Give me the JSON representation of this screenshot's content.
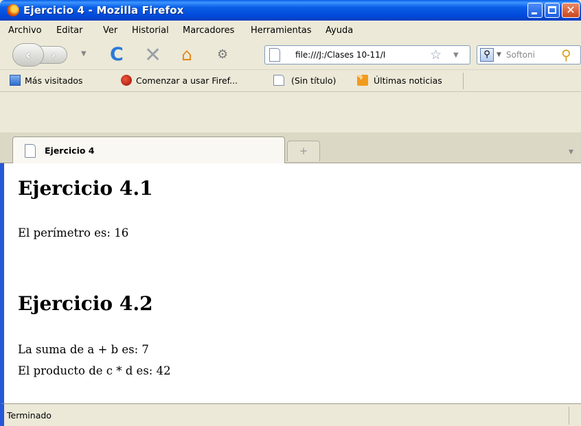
{
  "window": {
    "title": "Ejercicio 4 - Mozilla Firefox"
  },
  "menu": {
    "items": [
      {
        "label": "Archivo"
      },
      {
        "label": "Editar"
      },
      {
        "label": "Ver"
      },
      {
        "label": "Historial"
      },
      {
        "label": "Marcadores"
      },
      {
        "label": "Herramientas"
      },
      {
        "label": "Ayuda"
      }
    ]
  },
  "toolbar": {
    "back_icon": "back-arrow-icon",
    "forward_icon": "forward-arrow-icon",
    "reload_icon": "reload-icon",
    "stop_icon": "stop-icon",
    "home_icon": "home-icon",
    "url": "file:///J:/Clases 10-11/I",
    "search_placeholder": "Softoni"
  },
  "bookmarks": {
    "items": [
      {
        "label": "Más visitados"
      },
      {
        "label": "Comenzar a usar Firef..."
      },
      {
        "label": "(Sin título)"
      },
      {
        "label": "Últimas noticias"
      }
    ]
  },
  "tabs": {
    "active": {
      "label": "Ejercicio 4"
    },
    "new_tab_symbol": "+"
  },
  "page": {
    "section1": {
      "heading": "Ejercicio 4.1",
      "line1": "El perímetro es: 16"
    },
    "section2": {
      "heading": "Ejercicio 4.2",
      "line1": "La suma de a + b es: 7",
      "line2": "El producto de c * d es: 42"
    }
  },
  "status": {
    "text": "Terminado"
  },
  "colors": {
    "titlebar": "#0a5fe6",
    "chrome": "#ece9d8",
    "content_bg": "#ffffff"
  }
}
